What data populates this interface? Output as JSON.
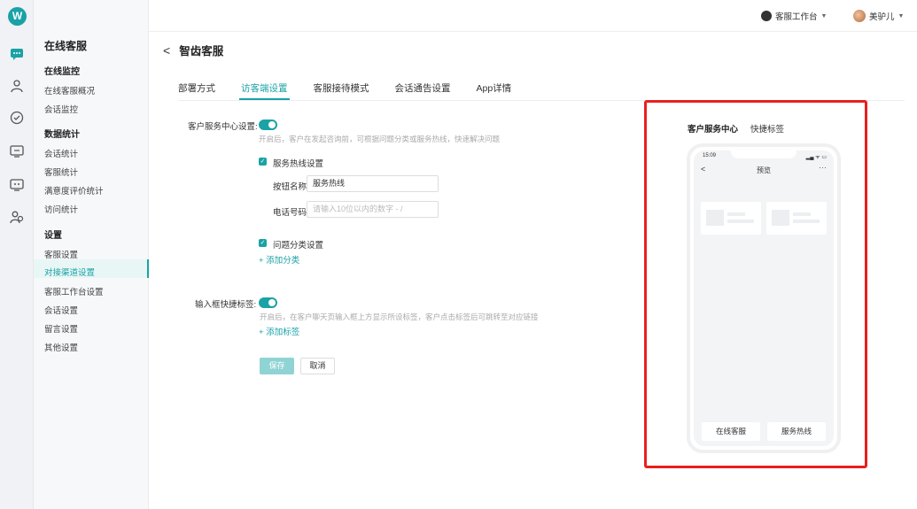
{
  "app": {
    "logo_glyph": "W",
    "accent": "#1aa2a6",
    "highlight": "#e8201d"
  },
  "rail": {
    "icons": [
      "chat-icon",
      "user-icon",
      "check-icon",
      "monitor-icon",
      "screen-icon",
      "people-icon"
    ]
  },
  "sidebar": {
    "title": "在线客服",
    "groups": [
      {
        "header": "在线监控",
        "items": [
          "在线客服概况",
          "会话监控"
        ]
      },
      {
        "header": "数据统计",
        "items": [
          "会话统计",
          "客服统计",
          "满意度评价统计",
          "访问统计"
        ]
      },
      {
        "header": "设置",
        "items": [
          "客服设置",
          "对接渠道设置",
          "客服工作台设置",
          "会话设置",
          "留言设置",
          "其他设置"
        ]
      }
    ],
    "active_item": "对接渠道设置"
  },
  "topbar": {
    "workspace": "客服工作台",
    "user": "美驴儿"
  },
  "page": {
    "back": "<",
    "title": "智齿客服"
  },
  "tabs": [
    "部署方式",
    "访客端设置",
    "客服接待模式",
    "会话通告设置",
    "App详情"
  ],
  "active_tab": "访客端设置",
  "form": {
    "service_center_label": "客户服务中心设置:",
    "service_center_hint": "开启后，客户在发起咨询前，可根据问题分类或服务热线，快速解决问题",
    "hotline_checkbox": "服务热线设置",
    "button_name_label": "按钮名称",
    "button_name_value": "服务热线",
    "phone_label": "电话号码",
    "phone_placeholder": "请输入10位以内的数字 - /",
    "category_checkbox": "问题分类设置",
    "add_category": "添加分类",
    "quick_tags_label": "输入框快捷标签:",
    "quick_tags_hint": "开启后，在客户聊天页输入框上方显示所设标签，客户点击标签后可跳转至对应链接",
    "add_tag": "添加标签",
    "save": "保存",
    "cancel": "取消"
  },
  "preview": {
    "tab_active": "客户服务中心",
    "tab_other": "快捷标签",
    "status_time": "15:09",
    "status_right": "▂▄ ᯤ ▭",
    "nav_title": "预览",
    "nav_back": "<",
    "nav_more": "···",
    "button_left": "在线客服",
    "button_right": "服务热线"
  }
}
